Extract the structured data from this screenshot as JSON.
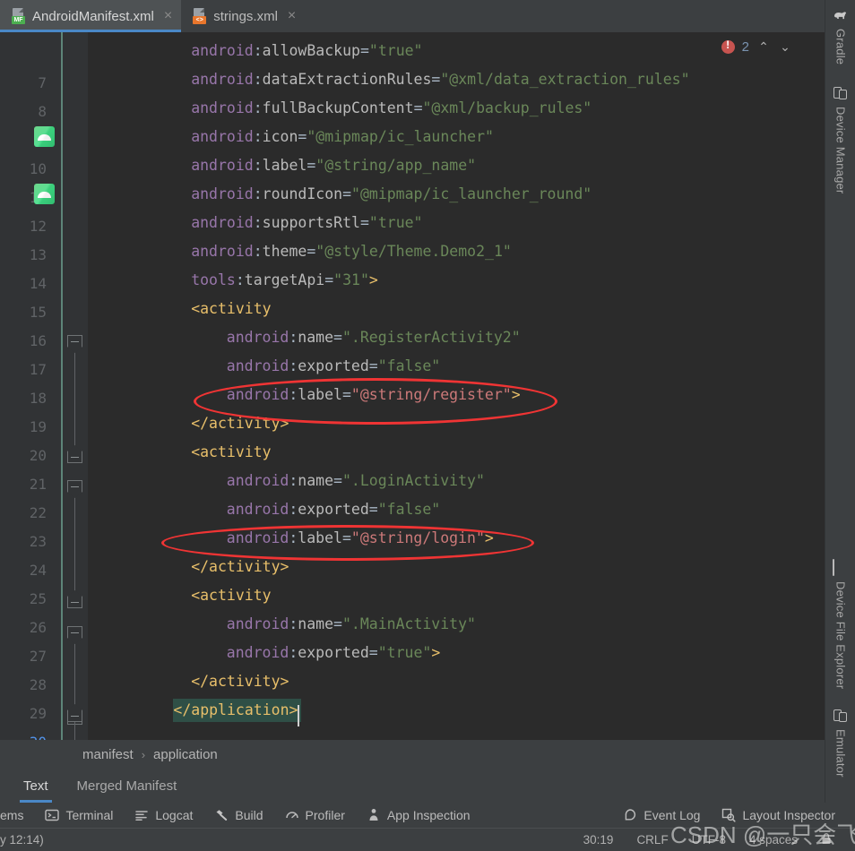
{
  "tabs": [
    {
      "label": "AndroidManifest.xml",
      "icon": "xml-manifest-file-icon",
      "badge": "MF",
      "active": true,
      "close": "×"
    },
    {
      "label": "strings.xml",
      "icon": "xml-file-icon",
      "badge": "<>",
      "active": false,
      "close": "×"
    }
  ],
  "editor": {
    "error_badge": {
      "icon": "error-icon",
      "count": "2"
    },
    "nav_up": "⌃",
    "nav_down": "⌄",
    "lines": [
      {
        "num": "7",
        "indent": 8,
        "tokens": [
          {
            "t": "ns",
            "v": "android"
          },
          {
            "t": "eq",
            "v": ":"
          },
          {
            "t": "attr",
            "v": "allowBackup"
          },
          {
            "t": "eq",
            "v": "="
          },
          {
            "t": "str",
            "v": "\"true\""
          }
        ]
      },
      {
        "num": "8",
        "indent": 8,
        "tokens": [
          {
            "t": "ns",
            "v": "android"
          },
          {
            "t": "eq",
            "v": ":"
          },
          {
            "t": "attr",
            "v": "dataExtractionRules"
          },
          {
            "t": "eq",
            "v": "="
          },
          {
            "t": "str",
            "v": "\"@xml/data_extraction_rules\""
          }
        ]
      },
      {
        "num": "9",
        "indent": 8,
        "tokens": [
          {
            "t": "ns",
            "v": "android"
          },
          {
            "t": "eq",
            "v": ":"
          },
          {
            "t": "attr",
            "v": "fullBackupContent"
          },
          {
            "t": "eq",
            "v": "="
          },
          {
            "t": "str",
            "v": "\"@xml/backup_rules\""
          }
        ]
      },
      {
        "num": "10",
        "indent": 8,
        "gutter_icon": "android-resource-icon",
        "tokens": [
          {
            "t": "ns",
            "v": "android"
          },
          {
            "t": "eq",
            "v": ":"
          },
          {
            "t": "attr",
            "v": "icon"
          },
          {
            "t": "eq",
            "v": "="
          },
          {
            "t": "str",
            "v": "\"@mipmap/ic_launcher\""
          }
        ]
      },
      {
        "num": "11",
        "indent": 8,
        "tokens": [
          {
            "t": "ns",
            "v": "android"
          },
          {
            "t": "eq",
            "v": ":"
          },
          {
            "t": "attr",
            "v": "label"
          },
          {
            "t": "eq",
            "v": "="
          },
          {
            "t": "str",
            "v": "\"@string/app_name\""
          }
        ]
      },
      {
        "num": "12",
        "indent": 8,
        "gutter_icon": "android-resource-icon",
        "tokens": [
          {
            "t": "ns",
            "v": "android"
          },
          {
            "t": "eq",
            "v": ":"
          },
          {
            "t": "attr",
            "v": "roundIcon"
          },
          {
            "t": "eq",
            "v": "="
          },
          {
            "t": "str",
            "v": "\"@mipmap/ic_launcher_round\""
          }
        ]
      },
      {
        "num": "13",
        "indent": 8,
        "tokens": [
          {
            "t": "ns",
            "v": "android"
          },
          {
            "t": "eq",
            "v": ":"
          },
          {
            "t": "attr",
            "v": "supportsRtl"
          },
          {
            "t": "eq",
            "v": "="
          },
          {
            "t": "str",
            "v": "\"true\""
          }
        ]
      },
      {
        "num": "14",
        "indent": 8,
        "tokens": [
          {
            "t": "ns",
            "v": "android"
          },
          {
            "t": "eq",
            "v": ":"
          },
          {
            "t": "attr",
            "v": "theme"
          },
          {
            "t": "eq",
            "v": "="
          },
          {
            "t": "str",
            "v": "\"@style/Theme.Demo2_1\""
          }
        ]
      },
      {
        "num": "15",
        "indent": 8,
        "tokens": [
          {
            "t": "ns",
            "v": "tools"
          },
          {
            "t": "eq",
            "v": ":"
          },
          {
            "t": "attr",
            "v": "targetApi"
          },
          {
            "t": "eq",
            "v": "="
          },
          {
            "t": "str",
            "v": "\"31\""
          },
          {
            "t": "tag",
            "v": ">"
          }
        ]
      },
      {
        "num": "16",
        "indent": 8,
        "tokens": [
          {
            "t": "tag",
            "v": "<activity"
          }
        ]
      },
      {
        "num": "17",
        "indent": 12,
        "tokens": [
          {
            "t": "ns",
            "v": "android"
          },
          {
            "t": "eq",
            "v": ":"
          },
          {
            "t": "attr",
            "v": "name"
          },
          {
            "t": "eq",
            "v": "="
          },
          {
            "t": "str",
            "v": "\".RegisterActivity2\""
          }
        ]
      },
      {
        "num": "18",
        "indent": 12,
        "tokens": [
          {
            "t": "ns",
            "v": "android"
          },
          {
            "t": "eq",
            "v": ":"
          },
          {
            "t": "attr",
            "v": "exported"
          },
          {
            "t": "eq",
            "v": "="
          },
          {
            "t": "str",
            "v": "\"false\""
          }
        ]
      },
      {
        "num": "19",
        "indent": 12,
        "tokens": [
          {
            "t": "ns",
            "v": "android"
          },
          {
            "t": "eq",
            "v": ":"
          },
          {
            "t": "attr",
            "v": "label"
          },
          {
            "t": "eq",
            "v": "="
          },
          {
            "t": "err",
            "v": "\"@string/register\""
          },
          {
            "t": "tag",
            "v": ">"
          }
        ]
      },
      {
        "num": "20",
        "indent": 8,
        "tokens": [
          {
            "t": "tag",
            "v": "</activity>"
          }
        ]
      },
      {
        "num": "21",
        "indent": 8,
        "tokens": [
          {
            "t": "tag",
            "v": "<activity"
          }
        ]
      },
      {
        "num": "22",
        "indent": 12,
        "tokens": [
          {
            "t": "ns",
            "v": "android"
          },
          {
            "t": "eq",
            "v": ":"
          },
          {
            "t": "attr",
            "v": "name"
          },
          {
            "t": "eq",
            "v": "="
          },
          {
            "t": "str",
            "v": "\".LoginActivity\""
          }
        ]
      },
      {
        "num": "23",
        "indent": 12,
        "tokens": [
          {
            "t": "ns",
            "v": "android"
          },
          {
            "t": "eq",
            "v": ":"
          },
          {
            "t": "attr",
            "v": "exported"
          },
          {
            "t": "eq",
            "v": "="
          },
          {
            "t": "str",
            "v": "\"false\""
          }
        ]
      },
      {
        "num": "24",
        "indent": 12,
        "tokens": [
          {
            "t": "ns",
            "v": "android"
          },
          {
            "t": "eq",
            "v": ":"
          },
          {
            "t": "attr",
            "v": "label"
          },
          {
            "t": "eq",
            "v": "="
          },
          {
            "t": "err",
            "v": "\"@string/login\""
          },
          {
            "t": "tag",
            "v": ">"
          }
        ]
      },
      {
        "num": "25",
        "indent": 8,
        "tokens": [
          {
            "t": "tag",
            "v": "</activity>"
          }
        ]
      },
      {
        "num": "26",
        "indent": 8,
        "tokens": [
          {
            "t": "tag",
            "v": "<activity"
          }
        ]
      },
      {
        "num": "27",
        "indent": 12,
        "tokens": [
          {
            "t": "ns",
            "v": "android"
          },
          {
            "t": "eq",
            "v": ":"
          },
          {
            "t": "attr",
            "v": "name"
          },
          {
            "t": "eq",
            "v": "="
          },
          {
            "t": "str",
            "v": "\".MainActivity\""
          }
        ]
      },
      {
        "num": "28",
        "indent": 12,
        "tokens": [
          {
            "t": "ns",
            "v": "android"
          },
          {
            "t": "eq",
            "v": ":"
          },
          {
            "t": "attr",
            "v": "exported"
          },
          {
            "t": "eq",
            "v": "="
          },
          {
            "t": "str",
            "v": "\"true\""
          },
          {
            "t": "tag",
            "v": ">"
          }
        ]
      },
      {
        "num": "29",
        "indent": 8,
        "tokens": [
          {
            "t": "tag",
            "v": "</activity>"
          }
        ]
      },
      {
        "num": "30",
        "indent": 6,
        "current": true,
        "tokens": [
          {
            "t": "tag",
            "v": "</application>"
          }
        ]
      }
    ]
  },
  "breadcrumbs": {
    "items": [
      "manifest",
      "application"
    ],
    "separator": "›"
  },
  "mode_tabs": [
    {
      "label": "Text",
      "active": true
    },
    {
      "label": "Merged Manifest",
      "active": false
    }
  ],
  "bottom_toolbar": [
    {
      "label": "ems",
      "icon": "problems-icon"
    },
    {
      "label": "Terminal",
      "icon": "terminal-icon"
    },
    {
      "label": "Logcat",
      "icon": "logcat-icon"
    },
    {
      "label": "Build",
      "icon": "hammer-icon"
    },
    {
      "label": "Profiler",
      "icon": "gauge-icon"
    },
    {
      "label": "App Inspection",
      "icon": "inspection-icon"
    },
    {
      "label": "Event Log",
      "icon": "event-log-icon"
    },
    {
      "label": "Layout Inspector",
      "icon": "layout-inspector-icon"
    }
  ],
  "status_bar": {
    "left": "y 12:14)",
    "caret": "30:19",
    "line_separator": "CRLF",
    "encoding": "UTF-8",
    "indent": "4 spaces",
    "lock_icon": "lock-icon"
  },
  "right_sidebar": [
    {
      "label": "Gradle",
      "icon": "gradle-elephant-icon"
    },
    {
      "label": "Device Manager",
      "icon": "device-manager-icon"
    },
    {
      "label": "Device File Explorer",
      "icon": "device-file-explorer-icon"
    },
    {
      "label": "Emulator",
      "icon": "emulator-icon"
    }
  ],
  "annotations": {
    "ellipses": [
      {
        "label": "register-label-highlight"
      },
      {
        "label": "login-label-highlight"
      }
    ],
    "accent_red": "#f03434"
  },
  "watermark": {
    "text": "CSDN @一只会飞的猪"
  }
}
